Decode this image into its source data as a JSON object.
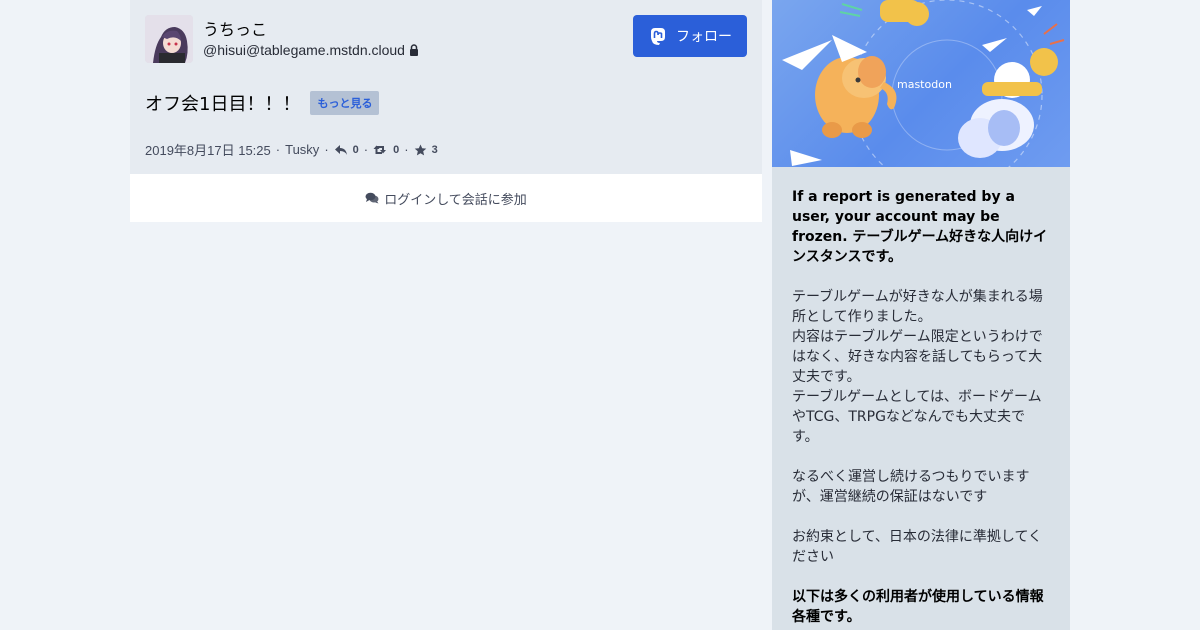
{
  "status": {
    "display_name": "うちっこ",
    "acct": "@hisui@tablegame.mstdn.cloud",
    "follow_label": "フォロー",
    "content": "オフ会1日目！！！",
    "more_label": "もっと見る",
    "date": "2019年8月17日 15:25",
    "application": "Tusky",
    "replies": "0",
    "reblogs": "0",
    "favourites": "3",
    "login_label": "ログインして会話に参加"
  },
  "sidebar": {
    "hero_logo_text": "mastodon",
    "headline": "If a report is generated by a user, your account may be frozen. テーブルゲーム好きな人向けインスタンスです。",
    "paragraph1": "テーブルゲームが好きな人が集まれる場所として作りました。\n内容はテーブルゲーム限定というわけではなく、好きな内容を話してもらって大丈夫です。\nテーブルゲームとしては、ボードゲームやTCG、TRPGなどなんでも大丈夫です。",
    "paragraph2": "なるべく運営し続けるつもりでいますが、運営継続の保証はないです",
    "paragraph3": "お約束として、日本の法律に準拠してください",
    "paragraph4": "以下は多くの利用者が使用している情報各種です。"
  },
  "colors": {
    "accent": "#2b5fd9",
    "background": "#eff3f8",
    "card": "#e6ebf1",
    "sidebar": "#d9e1e8"
  }
}
